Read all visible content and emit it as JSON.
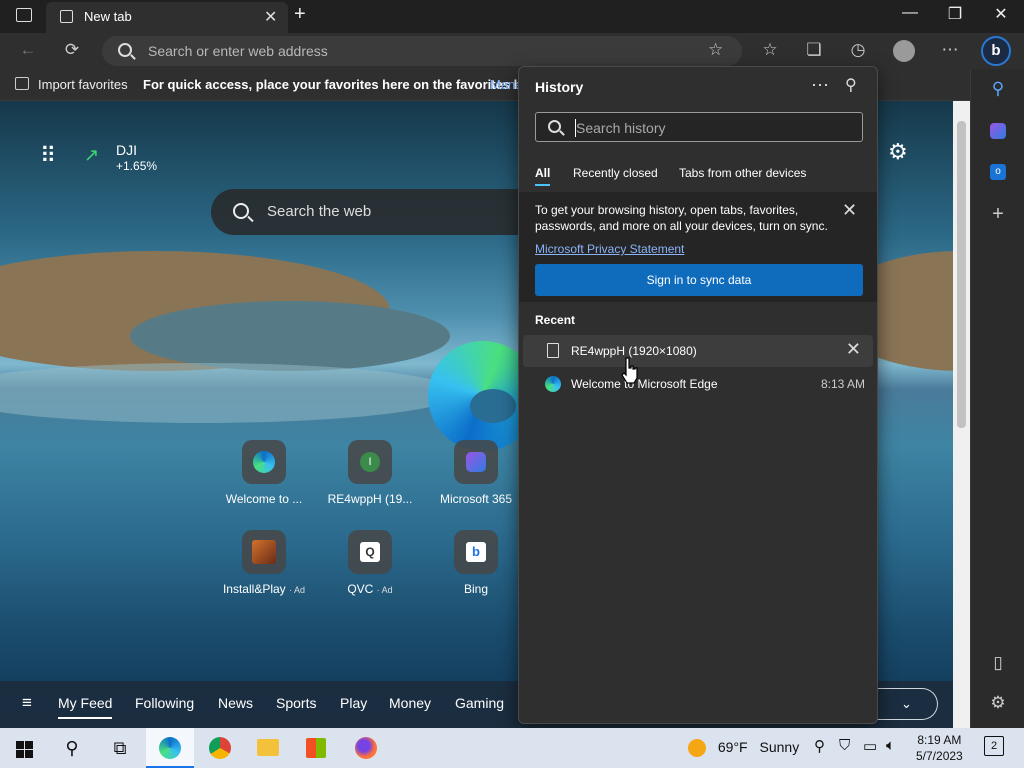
{
  "browser": {
    "tab_title": "New tab",
    "address_placeholder": "Search or enter web address"
  },
  "favorites_bar": {
    "import_label": "Import favorites",
    "message": "For quick access, place your favorites here on the favorites bar.",
    "manage_link": "Mana"
  },
  "newtab": {
    "ticker_name": "DJI",
    "ticker_change": "+1.65%",
    "search_placeholder": "Search the web",
    "quick_links": [
      {
        "label": "Welcome to ...",
        "ad": ""
      },
      {
        "label": "RE4wppH (19...",
        "ad": ""
      },
      {
        "label": "Microsoft 365",
        "ad": ""
      },
      {
        "label": "Install&Play",
        "ad": "· Ad"
      },
      {
        "label": "QVC",
        "ad": "· Ad"
      },
      {
        "label": "Bing",
        "ad": ""
      }
    ],
    "feed_tabs": [
      "My Feed",
      "Following",
      "News",
      "Sports",
      "Play",
      "Money",
      "Gaming"
    ]
  },
  "history": {
    "title": "History",
    "search_placeholder": "Search history",
    "tabs": [
      "All",
      "Recently closed",
      "Tabs from other devices"
    ],
    "sync_message": "To get your browsing history, open tabs, favorites, passwords, and more on all your devices, turn on sync.",
    "privacy_link": "Microsoft Privacy Statement",
    "sync_button": "Sign in to sync data",
    "recent_label": "Recent",
    "items": [
      {
        "title": "RE4wppH (1920×1080)",
        "time": ""
      },
      {
        "title": "Welcome to Microsoft Edge",
        "time": "8:13 AM"
      }
    ]
  },
  "taskbar": {
    "weather_temp": "69°F",
    "weather_desc": "Sunny",
    "time": "8:19 AM",
    "date": "5/7/2023",
    "notification_count": "2"
  }
}
